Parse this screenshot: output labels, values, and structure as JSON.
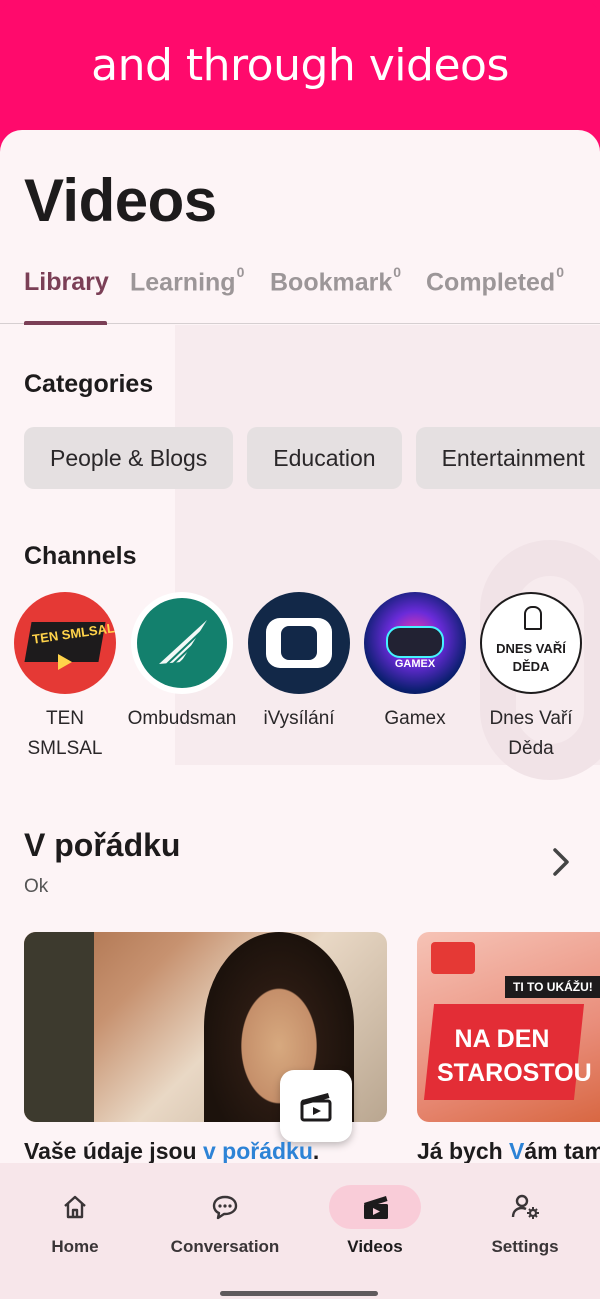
{
  "banner": {
    "text": "and through videos"
  },
  "page_title": "Videos",
  "tabs": [
    {
      "label": "Library",
      "count": ""
    },
    {
      "label": "Learning",
      "count": "0"
    },
    {
      "label": "Bookmark",
      "count": "0"
    },
    {
      "label": "Completed",
      "count": "0"
    }
  ],
  "categories": {
    "title": "Categories",
    "items": [
      "People & Blogs",
      "Education",
      "Entertainment"
    ]
  },
  "channels": {
    "title": "Channels",
    "items": [
      {
        "name": "TEN SMLSAL",
        "logo_text": "TEN SMLSAL"
      },
      {
        "name": "Ombudsman"
      },
      {
        "name": "iVysílání"
      },
      {
        "name": "Gamex",
        "logo_text": "GAMEX"
      },
      {
        "name": "Dnes Vaří Děda",
        "logo_text": "DNES VAŘÍ DĚDA"
      }
    ]
  },
  "playlist": {
    "title": "V pořádku",
    "subtitle": "Ok",
    "videos": [
      {
        "caption_pre": "Vaše údaje jsou ",
        "caption_hl": "v pořádku",
        "caption_post": "."
      },
      {
        "caption_pre": "Já bych ",
        "caption_hl": "V",
        "caption_post": "ám tam",
        "thumb_tag": "TI TO UKÁŽU!",
        "thumb_text": "NA DEN STAROSTOU"
      }
    ]
  },
  "bottom_nav": [
    {
      "label": "Home",
      "icon": "home-icon"
    },
    {
      "label": "Conversation",
      "icon": "chat-icon"
    },
    {
      "label": "Videos",
      "icon": "clapperboard-icon",
      "active": true
    },
    {
      "label": "Settings",
      "icon": "user-settings-icon"
    }
  ],
  "colors": {
    "banner": "#ff0a6c",
    "accent": "#7b3f56",
    "highlight": "#2d83d6"
  }
}
